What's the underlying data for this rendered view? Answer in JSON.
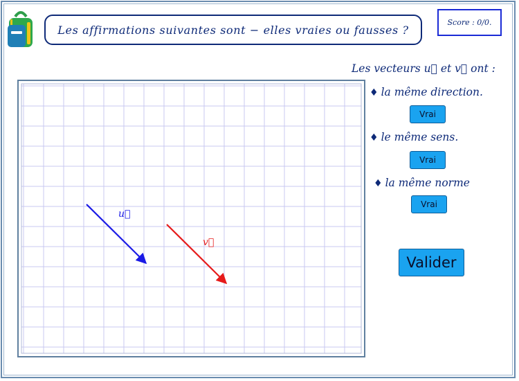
{
  "header": {
    "question": "Les affirmations suivantes sont − elles vraies ou fausses ?",
    "score": "Score : 0/0."
  },
  "panel": {
    "intro": "Les vecteurs u⃗ et v⃗ ont :",
    "statements": [
      {
        "text": "la même direction.",
        "button": "Vrai"
      },
      {
        "text": "le même sens.",
        "button": "Vrai"
      },
      {
        "text": "la même norme",
        "button": "Vrai"
      }
    ],
    "bullet": "♦",
    "validate_label": "Valider"
  },
  "figure": {
    "vectors": [
      {
        "label": "u⃗",
        "color": "#1a1ae6"
      },
      {
        "label": "v⃗",
        "color": "#e61a1a"
      }
    ],
    "grid_color": "#c8c8f0"
  },
  "colors": {
    "text": "#0e2a78",
    "button": "#1aa3f0"
  }
}
